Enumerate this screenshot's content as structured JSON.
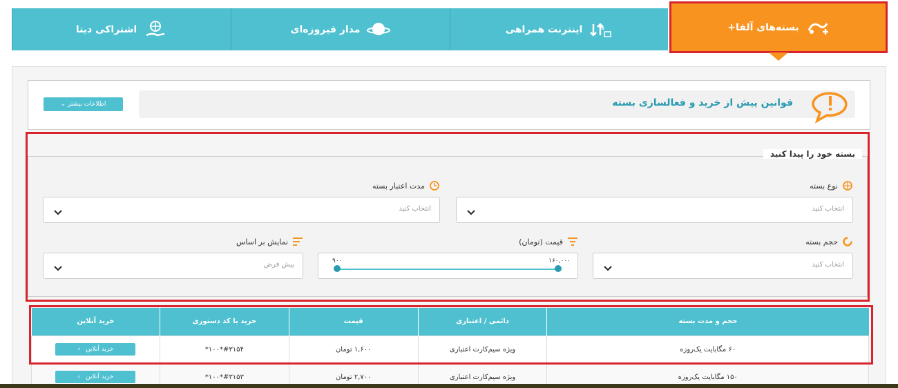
{
  "tabs": [
    {
      "label": "بسته‌های آلفا+",
      "icon": "alpha-plus-icon",
      "active": true
    },
    {
      "label": "اینترنت همراهی",
      "icon": "transfer-arrows-icon",
      "active": false
    },
    {
      "label": "مدار فیروزه‌ای",
      "icon": "planet-icon",
      "active": false
    },
    {
      "label": "اشتراکی دیتا",
      "icon": "hand-globe-icon",
      "active": false
    }
  ],
  "rules": {
    "title": "قوانین پیش از خرید و فعالسازی بسته",
    "more_label": "اطلاعات بیشتر ⌄",
    "icon": "alert-bubble-icon"
  },
  "search": {
    "title": "بسته خود را پیدا کنید",
    "type_label": "نوع بسته",
    "type_placeholder": "انتخاب کنید",
    "duration_label": "مدت اعتبار بسته",
    "duration_placeholder": "انتخاب کنید",
    "volume_label": "حجم بسته",
    "volume_placeholder": "انتخاب کنید",
    "price_label": "قیمت (تومان)",
    "price_min": "۹۰۰",
    "price_max": "۱۶۰,۰۰۰",
    "sort_label": "نمایش بر اساس",
    "sort_placeholder": "پیش فرض"
  },
  "table": {
    "headers": [
      "حجم و مدت بسته",
      "دائمی / اعتباری",
      "قیمت",
      "خرید با کد دستوری",
      "خرید آنلاین"
    ],
    "rows": [
      {
        "volume": "۶۰ مگابایت یک‌روزه",
        "sim": "ویژه سیم‌کارت اعتباری",
        "price": "۱,۶۰۰ تومان",
        "ussd": "#۳۱۵۴*۱۰۰*",
        "buy": "خرید آنلاین"
      },
      {
        "volume": "۱۵۰ مگابایت یک‌روزه",
        "sim": "ویژه سیم‌کارت اعتباری",
        "price": "۲,۷۰۰ تومان",
        "ussd": "#۳۱۵۳*۱۰۰*",
        "buy": "خرید آنلاین"
      }
    ]
  },
  "colors": {
    "teal": "#4fc0d0",
    "orange": "#f7931e",
    "highlight": "#d9232d"
  }
}
